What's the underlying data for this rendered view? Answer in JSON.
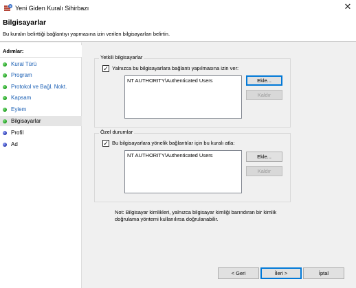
{
  "window": {
    "title": "Yeni Giden Kuralı Sihirbazı",
    "close_glyph": "✕"
  },
  "header": {
    "title": "Bilgisayarlar",
    "subtitle": "Bu kuralın belirttiği bağlantıyı yapmasına izin verilen bilgisayarları belirtin."
  },
  "sidebar": {
    "heading": "Adımlar:",
    "steps": [
      {
        "label": "Kural Türü",
        "state": "done"
      },
      {
        "label": "Program",
        "state": "done"
      },
      {
        "label": "Protokol ve Bağl. Nokt.",
        "state": "done"
      },
      {
        "label": "Kapsam",
        "state": "done"
      },
      {
        "label": "Eylem",
        "state": "done"
      },
      {
        "label": "Bilgisayarlar",
        "state": "current"
      },
      {
        "label": "Profil",
        "state": "todo"
      },
      {
        "label": "Ad",
        "state": "todo"
      }
    ]
  },
  "authorized": {
    "legend": "Yetkili bilgisayarlar",
    "checkbox_label": "Yalnızca bu bilgisayarlara bağlantı yapılmasına izin ver:",
    "checked": true,
    "list_items": [
      "NT AUTHORITY\\Authenticated Users"
    ],
    "add_label": "Ekle...",
    "remove_label": "Kaldır"
  },
  "exceptions": {
    "legend": "Özel durumlar",
    "checkbox_label": "Bu bilgisayarlara yönelik bağlantılar için bu kuralı atla:",
    "checked": true,
    "list_items": [
      "NT AUTHORITY\\Authenticated Users"
    ],
    "add_label": "Ekle...",
    "remove_label": "Kaldır"
  },
  "note": {
    "line1": "Not: Bilgisayar kimlikleri, yalnızca bilgisayar kimliği barındıran bir kimlik",
    "line2": "doğrulama yöntemi kullanılırsa doğrulanabilir."
  },
  "footer": {
    "back_label": "< Geri",
    "next_label": "İleri >",
    "cancel_label": "İptal"
  },
  "check_glyph": "✓",
  "colors": {
    "link_blue": "#1a5fb4",
    "current_step_bg": "#e5e5e5",
    "focus_border": "#0078d7"
  }
}
